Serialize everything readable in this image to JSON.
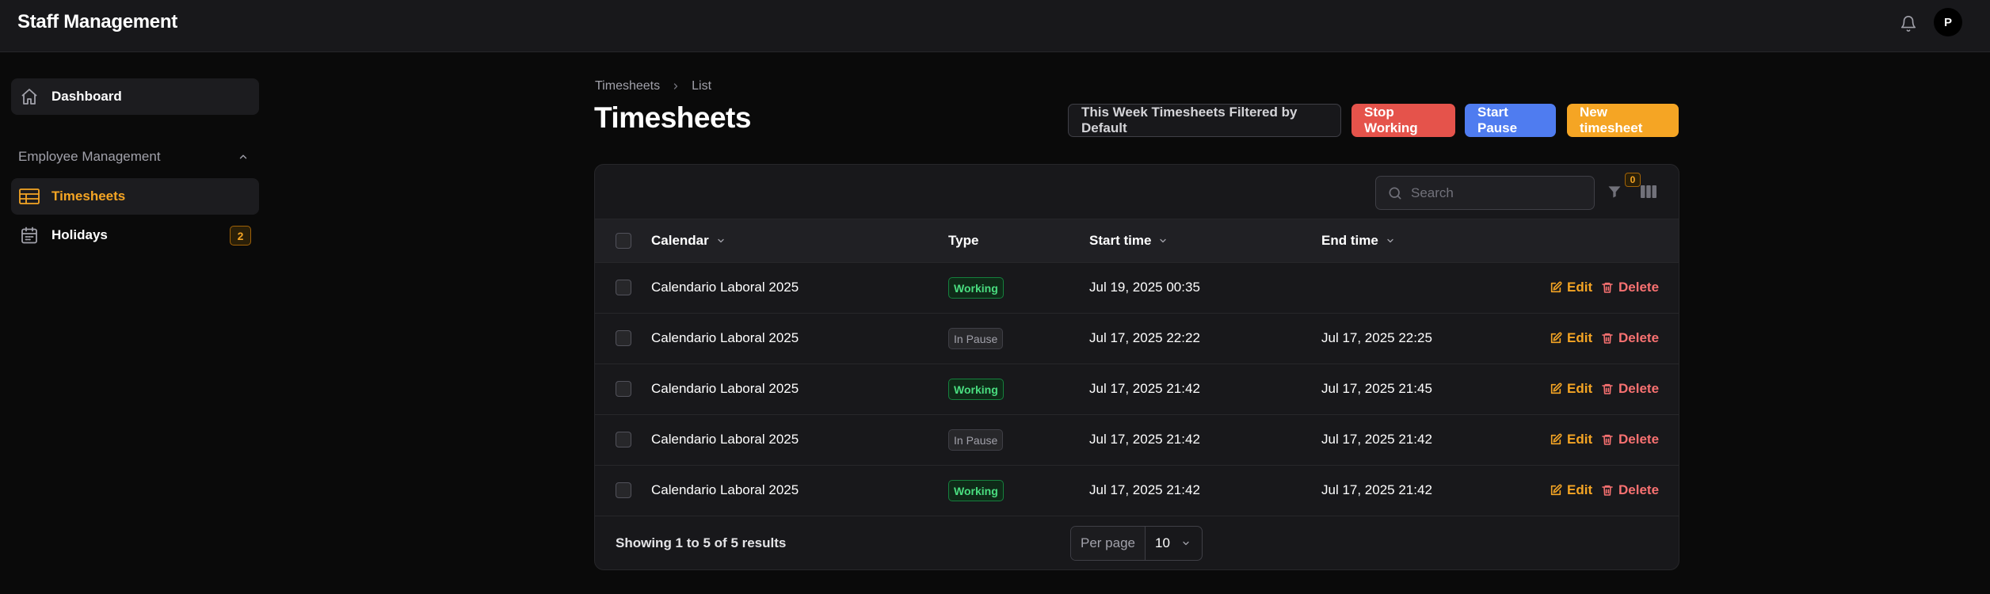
{
  "app": {
    "title": "Staff Management",
    "avatar_initial": "P"
  },
  "sidebar": {
    "dashboard_label": "Dashboard",
    "group_label": "Employee Management",
    "items": [
      {
        "label": "Timesheets",
        "active": true
      },
      {
        "label": "Holidays",
        "badge": "2"
      }
    ]
  },
  "breadcrumb": {
    "parent": "Timesheets",
    "current": "List"
  },
  "header": {
    "title": "Timesheets",
    "filter_button": "This Week Timesheets Filtered by Default",
    "stop_button": "Stop Working",
    "pause_button": "Start Pause",
    "new_button": "New timesheet"
  },
  "table": {
    "search_placeholder": "Search",
    "filter_count": "0",
    "columns": {
      "calendar": "Calendar",
      "type": "Type",
      "start": "Start time",
      "end": "End time"
    },
    "rows": [
      {
        "calendar": "Calendario Laboral 2025",
        "type": "Working",
        "start": "Jul 19, 2025 00:35",
        "end": ""
      },
      {
        "calendar": "Calendario Laboral 2025",
        "type": "In Pause",
        "start": "Jul 17, 2025 22:22",
        "end": "Jul 17, 2025 22:25"
      },
      {
        "calendar": "Calendario Laboral 2025",
        "type": "Working",
        "start": "Jul 17, 2025 21:42",
        "end": "Jul 17, 2025 21:45"
      },
      {
        "calendar": "Calendario Laboral 2025",
        "type": "In Pause",
        "start": "Jul 17, 2025 21:42",
        "end": "Jul 17, 2025 21:42"
      },
      {
        "calendar": "Calendario Laboral 2025",
        "type": "Working",
        "start": "Jul 17, 2025 21:42",
        "end": "Jul 17, 2025 21:42"
      }
    ],
    "edit_label": "Edit",
    "delete_label": "Delete",
    "results_text": "Showing 1 to 5 of 5 results",
    "per_page_label": "Per page",
    "per_page_value": "10"
  },
  "colors": {
    "accent": "#f5a524",
    "stop": "#e5534b",
    "pause": "#4f7cf0",
    "working": "#4ade80",
    "delete": "#f87171"
  }
}
